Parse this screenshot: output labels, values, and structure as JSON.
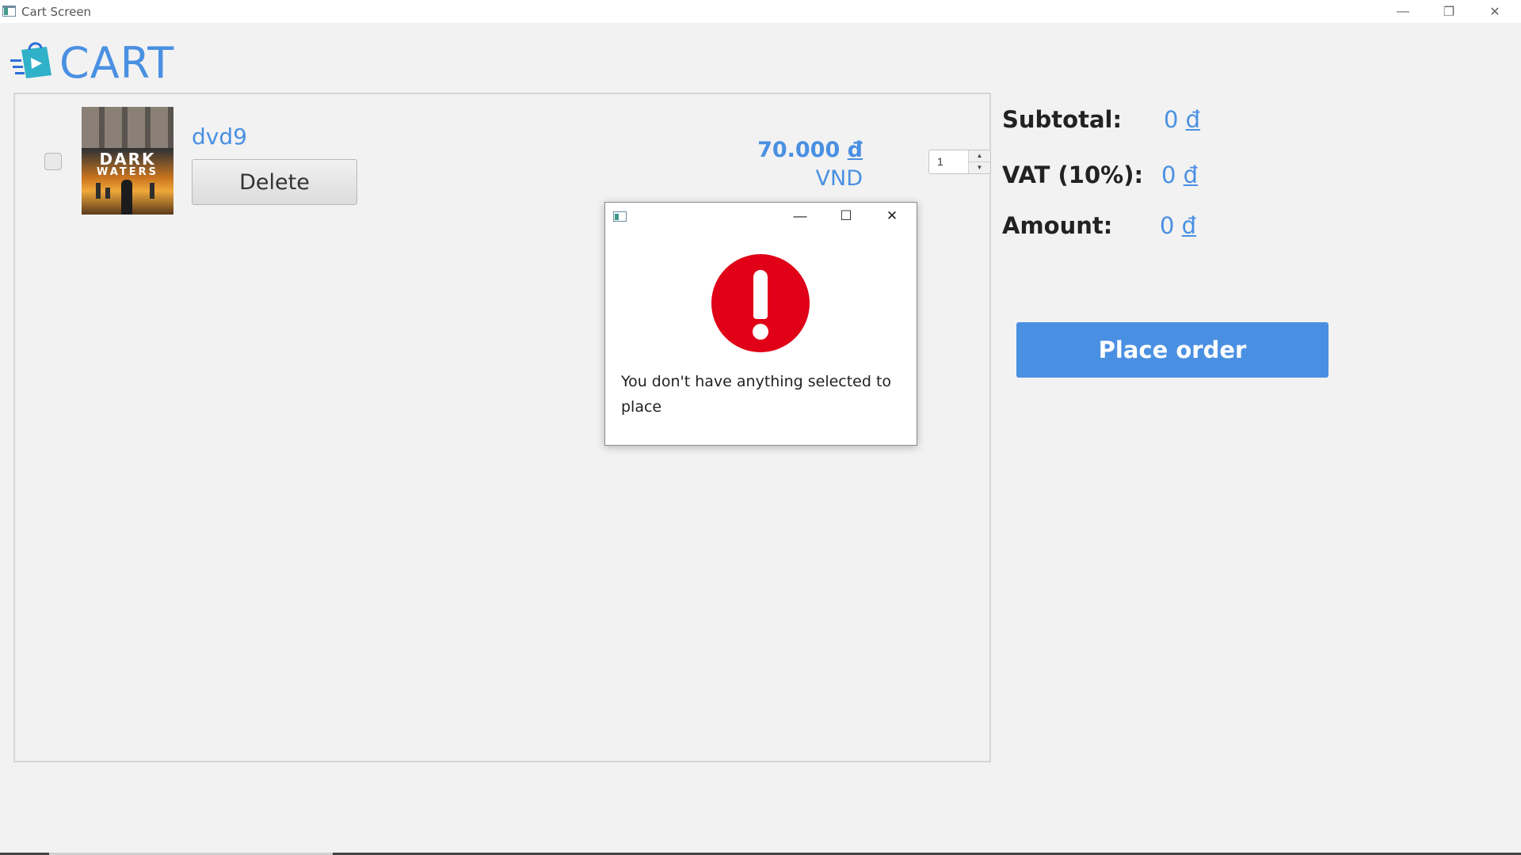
{
  "window": {
    "title": "Cart Screen",
    "controls": {
      "minimize": "—",
      "restore": "❐",
      "close": "✕"
    }
  },
  "header": {
    "title": "CART",
    "logo_icon": "shopping-bag-icon"
  },
  "cart": {
    "items": [
      {
        "selected": false,
        "thumbnail_title_line1": "DARK",
        "thumbnail_title_line2": "WATERS",
        "name": "dvd9",
        "delete_label": "Delete",
        "price": "70.000",
        "price_symbol": "đ",
        "currency": "VND",
        "quantity": "1"
      }
    ]
  },
  "summary": {
    "subtotal_label": "Subtotal:",
    "subtotal_value": "0",
    "vat_label": "VAT (10%):",
    "vat_value": "0",
    "amount_label": "Amount:",
    "amount_value": "0",
    "currency_symbol": "đ",
    "place_order_label": "Place order"
  },
  "dialog": {
    "icon": "error-icon",
    "message": "You don't have anything selected to place",
    "controls": {
      "minimize": "—",
      "maximize": "☐",
      "close": "✕"
    }
  },
  "colors": {
    "accent": "#4a90e2",
    "error": "#e00017",
    "background": "#f2f2f2"
  }
}
